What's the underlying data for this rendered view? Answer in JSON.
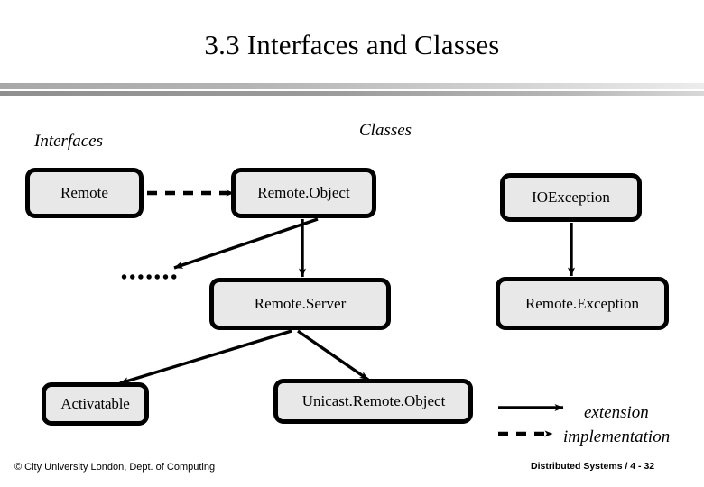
{
  "slide": {
    "title": "3.3 Interfaces and Classes",
    "captions": {
      "interfaces": "Interfaces",
      "classes": "Classes"
    },
    "ellipsis": "•••••••"
  },
  "nodes": [
    {
      "id": "remote",
      "label": "Remote",
      "kind": "interface"
    },
    {
      "id": "remote_object",
      "label": "Remote.Object",
      "kind": "class"
    },
    {
      "id": "ioexception",
      "label": "IOException",
      "kind": "class"
    },
    {
      "id": "remote_server",
      "label": "Remote.Server",
      "kind": "class"
    },
    {
      "id": "remote_exception",
      "label": "Remote.Exception",
      "kind": "class"
    },
    {
      "id": "activatable",
      "label": "Activatable",
      "kind": "class"
    },
    {
      "id": "unicast_remote_object",
      "label": "Unicast.Remote.Object",
      "kind": "class"
    }
  ],
  "edges": [
    {
      "from": "remote",
      "to": "remote_object",
      "style": "implementation"
    },
    {
      "from": "remote_object",
      "to": "ellipsis",
      "style": "extension"
    },
    {
      "from": "remote_object",
      "to": "remote_server",
      "style": "extension"
    },
    {
      "from": "remote_server",
      "to": "activatable",
      "style": "extension"
    },
    {
      "from": "remote_server",
      "to": "unicast_remote_object",
      "style": "extension"
    },
    {
      "from": "ioexception",
      "to": "remote_exception",
      "style": "extension"
    }
  ],
  "legend": {
    "extension": "extension",
    "implementation": "implementation"
  },
  "footer": {
    "left": "© City University London, Dept. of Computing",
    "right": "Distributed Systems / 4 - 32"
  },
  "colors": {
    "node_fill": "#e8e8e8",
    "node_border": "#000000",
    "background": "#ffffff",
    "text": "#000000"
  }
}
